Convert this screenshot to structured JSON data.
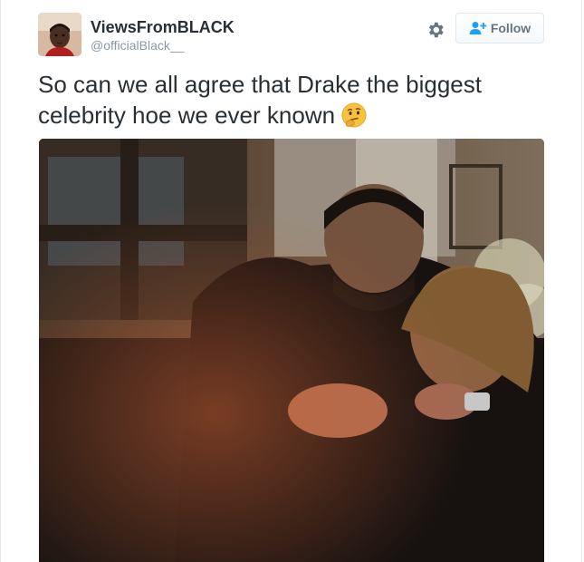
{
  "user": {
    "display_name": "ViewsFromBLACK",
    "handle": "@officialBlack__",
    "avatar_icon": "avatar-photo"
  },
  "actions": {
    "settings_icon": "gear-icon",
    "follow_label": "Follow",
    "follow_icon": "add-user-icon"
  },
  "tweet": {
    "text": "So can we all agree that Drake the biggest celebrity hoe we ever known",
    "emoji": "thinking-face-emoji"
  },
  "media": {
    "type": "photo"
  },
  "colors": {
    "text": "#292f33",
    "muted": "#8899a6",
    "button_text": "#66757f",
    "border": "#e1e8ed",
    "accent": "#1da1f2"
  }
}
